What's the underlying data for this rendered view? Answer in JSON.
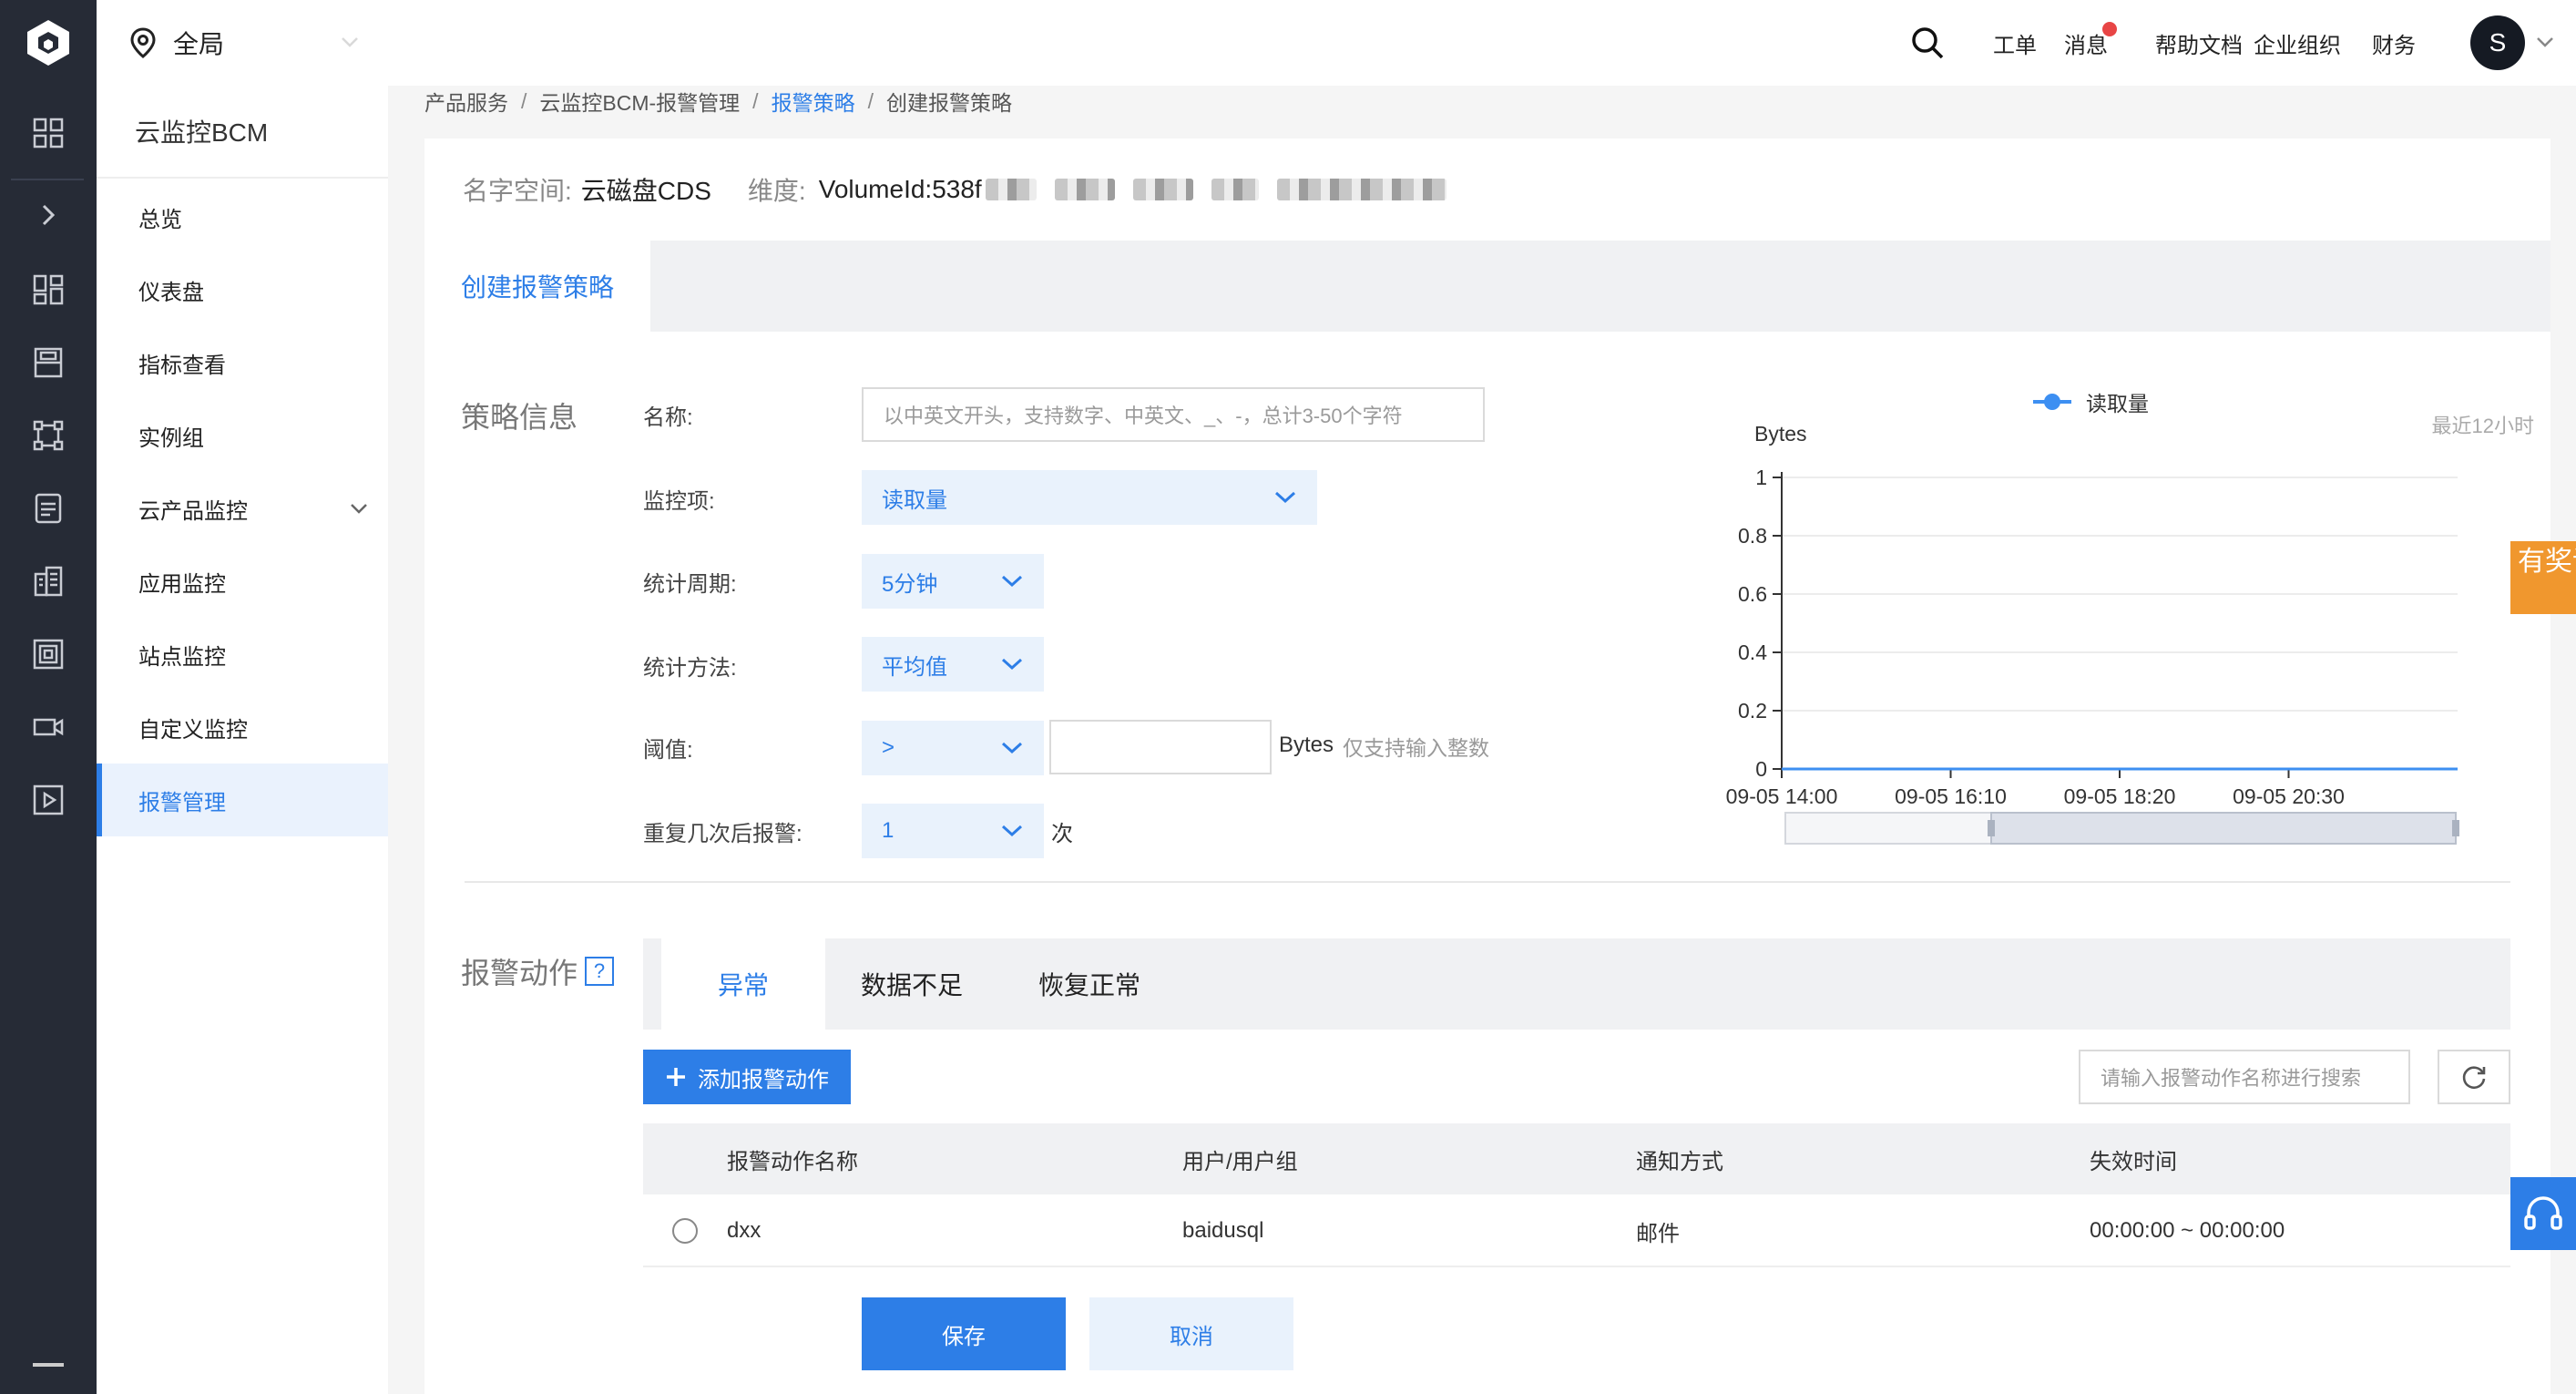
{
  "topbar": {
    "region_label": "全局",
    "links": [
      "工单",
      "消息",
      "帮助文档",
      "企业组织",
      "财务"
    ],
    "avatar_letter": "S"
  },
  "sidenav": {
    "title": "云监控BCM",
    "items": [
      {
        "label": "总览"
      },
      {
        "label": "仪表盘"
      },
      {
        "label": "指标查看"
      },
      {
        "label": "实例组"
      },
      {
        "label": "云产品监控"
      },
      {
        "label": "应用监控"
      },
      {
        "label": "站点监控"
      },
      {
        "label": "自定义监控"
      },
      {
        "label": "报警管理",
        "active": true
      }
    ]
  },
  "breadcrumb": [
    "产品服务",
    "云监控BCM-报警管理",
    "报警策略",
    "创建报警策略"
  ],
  "instance": {
    "namespace_label": "名字空间:",
    "namespace_value": "云磁盘CDS",
    "dimension_label": "维度:",
    "dimension_value": "VolumeId:538f"
  },
  "tab_title": "创建报警策略",
  "policy": {
    "section_title": "策略信息",
    "name_label": "名称:",
    "name_placeholder": "以中英文开头，支持数字、中英文、_、-，总计3-50个字符",
    "metric_label": "监控项:",
    "metric_value": "读取量",
    "period_label": "统计周期:",
    "period_value": "5分钟",
    "method_label": "统计方法:",
    "method_value": "平均值",
    "threshold_label": "阈值:",
    "threshold_operator": ">",
    "threshold_value": "",
    "threshold_unit": "Bytes",
    "threshold_hint": "仅支持输入整数",
    "repeat_label": "重复几次后报警:",
    "repeat_value": "1",
    "repeat_unit": "次"
  },
  "chart_data": {
    "type": "line",
    "title": "",
    "ylabel": "Bytes",
    "xlabel": "",
    "range_note": "最近12小时",
    "legend": "读取量",
    "series": [
      {
        "name": "读取量",
        "values": [
          0,
          0,
          0,
          0,
          0
        ]
      }
    ],
    "x": [
      "09-05 14:00",
      "09-05 16:10",
      "09-05 18:20",
      "09-05 20:30",
      ""
    ],
    "ylim": [
      0,
      1
    ],
    "yticks": [
      "0",
      "0.2",
      "0.4",
      "0.6",
      "0.8",
      "1"
    ],
    "xticks": [
      "09-05 14:00",
      "09-05 16:10",
      "09-05 18:20",
      "09-05 20:30"
    ],
    "grid": true,
    "color": "#3d8ff2"
  },
  "actions": {
    "section_title": "报警动作",
    "help_glyph": "?",
    "tabs": [
      "异常",
      "数据不足",
      "恢复正常"
    ],
    "add_label": "添加报警动作",
    "search_placeholder": "请输入报警动作名称进行搜索",
    "columns": [
      "报警动作名称",
      "用户/用户组",
      "通知方式",
      "失效时间"
    ],
    "rows": [
      {
        "name": "dxx",
        "user": "baidusql",
        "notify": "邮件",
        "expire": "00:00:00 ~ 00:00:00"
      }
    ]
  },
  "buttons": {
    "save": "保存",
    "cancel": "取消"
  },
  "float": {
    "survey": "有奖调研"
  },
  "colors": {
    "accent": "#2d7ee7",
    "rail": "#262b36",
    "survey": "#f0972e",
    "badge": "#e84545"
  }
}
